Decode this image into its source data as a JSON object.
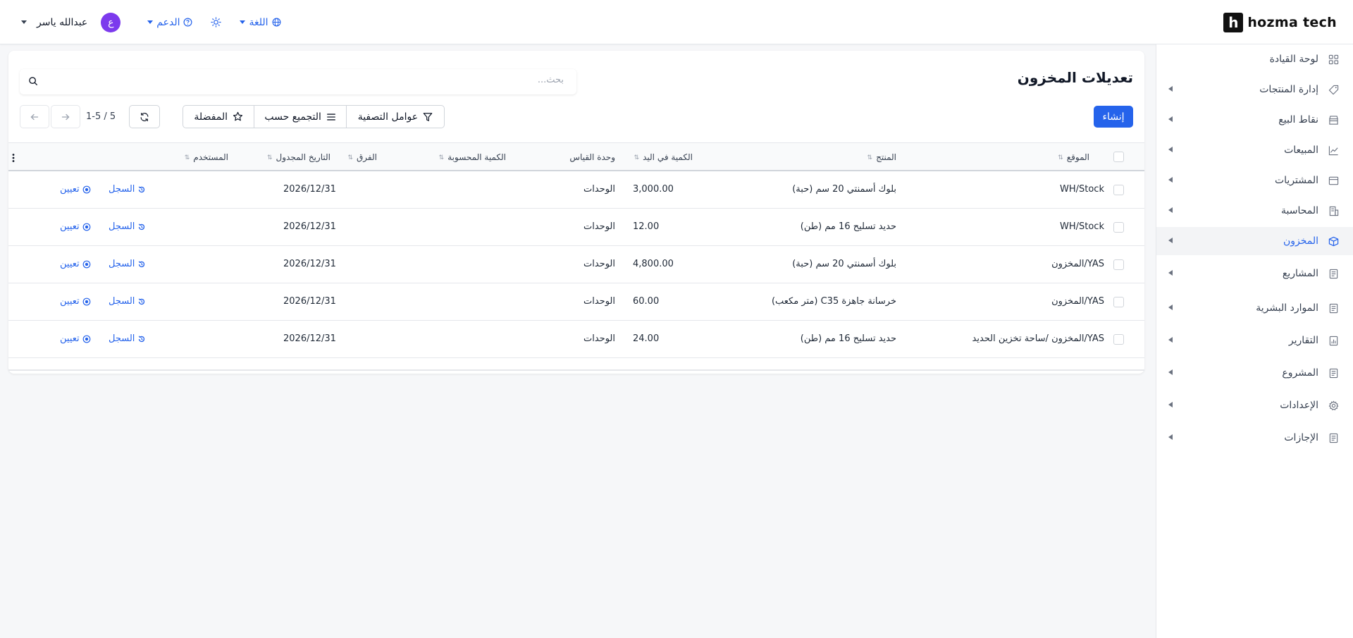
{
  "topbar": {
    "logo_mark": "h",
    "logo_text": "hozma tech",
    "user_name": "عبدالله ياسر",
    "avatar_letter": "ع",
    "support_label": "الدعم",
    "language_label": "اللغة"
  },
  "sidebar": {
    "items": [
      {
        "label": "لوحة القيادة",
        "icon": "dashboard-icon"
      },
      {
        "label": "إدارة المنتجات",
        "icon": "tag-icon"
      },
      {
        "label": "نقاط البيع",
        "icon": "store-icon"
      },
      {
        "label": "المبيعات",
        "icon": "chart-icon"
      },
      {
        "label": "المشتريات",
        "icon": "purchase-icon"
      },
      {
        "label": "المحاسبة",
        "icon": "accounting-icon"
      },
      {
        "label": "المخزون",
        "icon": "box-icon"
      },
      {
        "label": "المشاريع",
        "icon": "doc-icon"
      },
      {
        "label": "الموارد البشرية",
        "icon": "doc-icon"
      },
      {
        "label": "التقارير",
        "icon": "report-icon"
      },
      {
        "label": "المشروع",
        "icon": "doc-icon"
      },
      {
        "label": "الإعدادات",
        "icon": "gear-icon"
      },
      {
        "label": "الإجازات",
        "icon": "doc-icon"
      }
    ],
    "active": "المخزون",
    "accent": "#2563eb"
  },
  "main": {
    "title": "تعديلات المخزون",
    "search_placeholder": "بحث...",
    "create_label": "إنشاء",
    "filters_label": "عوامل التصفية",
    "group_by_label": "التجميع حسب",
    "favorites_label": "المفضلة",
    "pager": "1-5 / 5"
  },
  "table": {
    "headers": {
      "location": "الموقع",
      "product": "المنتج",
      "on_hand": "الكمية في اليد",
      "uom": "وحدة القياس",
      "computed": "الكمية المحسوبة",
      "difference": "الفرق",
      "scheduled_date": "التاريخ المجدول",
      "user": "المستخدم"
    },
    "history_label": "السجل",
    "assign_label": "تعيين",
    "rows": [
      {
        "location": "WH/Stock",
        "product": "بلوك أسمنتي 20 سم (حبة)",
        "on_hand": "3,000.00",
        "uom": "الوحدات",
        "date": "2026/12/31"
      },
      {
        "location": "WH/Stock",
        "product": "حديد تسليح 16 مم (طن)",
        "on_hand": "12.00",
        "uom": "الوحدات",
        "date": "2026/12/31"
      },
      {
        "location": "YAS/المخزون",
        "product": "بلوك أسمنتي 20 سم (حبة)",
        "on_hand": "4,800.00",
        "uom": "الوحدات",
        "date": "2026/12/31"
      },
      {
        "location": "YAS/المخزون",
        "product": "خرسانة جاهزة C35 (متر مكعب)",
        "on_hand": "60.00",
        "uom": "الوحدات",
        "date": "2026/12/31"
      },
      {
        "location": "YAS/المخزون /ساحة تخزين الحديد",
        "product": "حديد تسليح 16 مم (طن)",
        "on_hand": "24.00",
        "uom": "الوحدات",
        "date": "2026/12/31"
      }
    ]
  }
}
